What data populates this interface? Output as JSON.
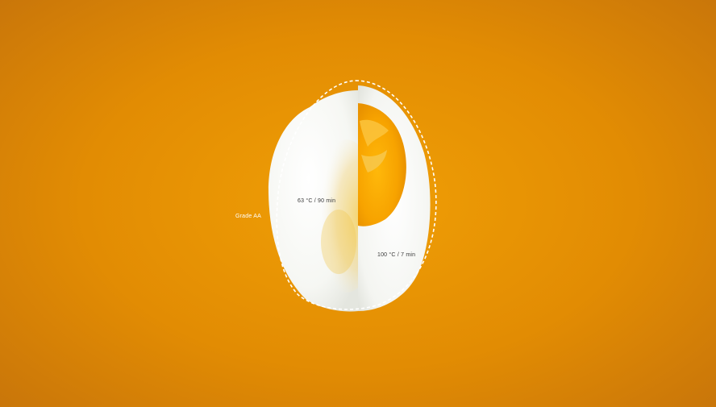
{
  "annotations": {
    "grade": "Grade AA",
    "left_half": "63 °C / 90 min",
    "right_half": "100 °C / 7 min"
  },
  "colors": {
    "background": "#e8930a",
    "egg_white": "#f7f7f2",
    "yolk": "#f2a404",
    "outline": "#ffffff"
  }
}
